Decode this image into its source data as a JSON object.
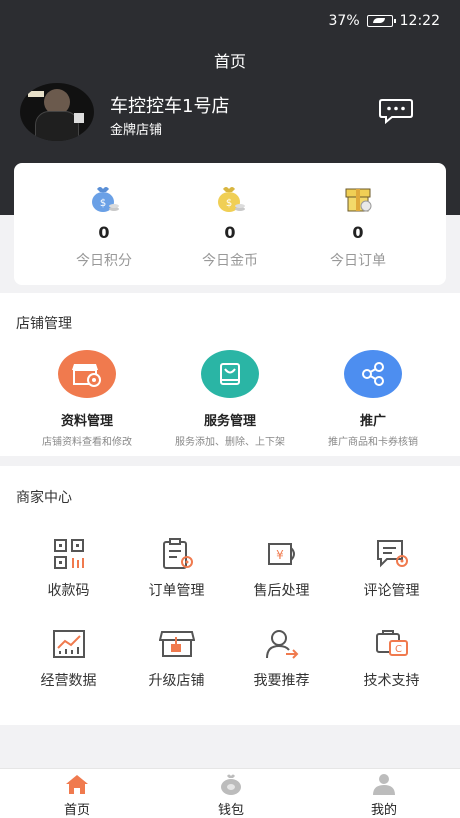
{
  "status_bar": {
    "battery": "37%",
    "time": "12:22"
  },
  "header": {
    "title": "首页"
  },
  "shop": {
    "name": "车控控车1号店",
    "level": "金牌店铺"
  },
  "stats": [
    {
      "value": "0",
      "label": "今日积分",
      "icon": "money-bag-icon"
    },
    {
      "value": "0",
      "label": "今日金币",
      "icon": "coin-bag-icon"
    },
    {
      "value": "0",
      "label": "今日订单",
      "icon": "gift-box-icon"
    }
  ],
  "shop_management": {
    "title": "店铺管理",
    "items": [
      {
        "name": "资料管理",
        "desc": "店铺资料查看和修改",
        "color": "#f07a4e",
        "icon": "store-settings-icon"
      },
      {
        "name": "服务管理",
        "desc": "服务添加、删除、上下架",
        "color": "#2ab5a5",
        "icon": "shopping-bag-icon"
      },
      {
        "name": "推广",
        "desc": "推广商品和卡券核销",
        "color": "#4d8ef0",
        "icon": "share-icon"
      }
    ]
  },
  "merchant_center": {
    "title": "商家中心",
    "items": [
      {
        "label": "收款码",
        "icon": "qr-code-icon"
      },
      {
        "label": "订单管理",
        "icon": "order-icon"
      },
      {
        "label": "售后处理",
        "icon": "after-sales-icon"
      },
      {
        "label": "评论管理",
        "icon": "comment-icon"
      },
      {
        "label": "经营数据",
        "icon": "chart-icon"
      },
      {
        "label": "升级店铺",
        "icon": "upgrade-store-icon"
      },
      {
        "label": "我要推荐",
        "icon": "recommend-user-icon"
      },
      {
        "label": "技术支持",
        "icon": "tech-support-icon"
      }
    ]
  },
  "tabs": [
    {
      "label": "首页",
      "icon": "home-icon",
      "active": true
    },
    {
      "label": "钱包",
      "icon": "wallet-icon",
      "active": false
    },
    {
      "label": "我的",
      "icon": "profile-icon",
      "active": false
    }
  ],
  "colors": {
    "header_bg": "#2c2d31",
    "accent": "#f07a4e",
    "icon_stroke": "#555555",
    "icon_accent": "#f07a4e"
  }
}
